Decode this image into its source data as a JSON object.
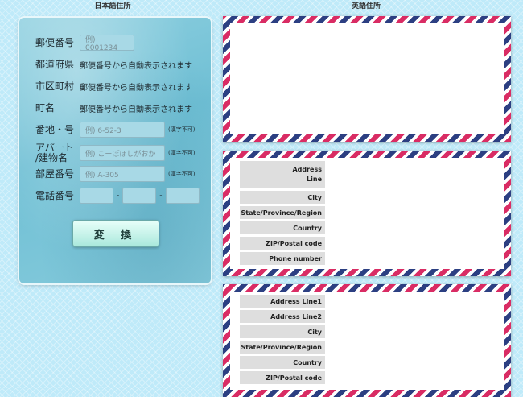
{
  "headings": {
    "japanese": "日本語住所",
    "english": "英語住所"
  },
  "form": {
    "postal": {
      "label": "郵便番号",
      "placeholder": "例) 0001234"
    },
    "prefecture": {
      "label": "都道府県",
      "auto": "郵便番号から自動表示されます"
    },
    "city": {
      "label": "市区町村",
      "auto": "郵便番号から自動表示されます"
    },
    "town": {
      "label": "町名",
      "auto": "郵便番号から自動表示されます"
    },
    "banchi": {
      "label": "番地・号",
      "placeholder": "例) 6-52-3",
      "note": "(漢字不可)"
    },
    "building": {
      "label_line1": "アパート",
      "label_line2": "/建物名",
      "placeholder": "例) こーぽほしがおか",
      "note": "(漢字不可)"
    },
    "room": {
      "label": "部屋番号",
      "placeholder": "例) A-305",
      "note": "(漢字不可)"
    },
    "phone": {
      "label": "電話番号",
      "sep": "-"
    },
    "convert_label": "変 換"
  },
  "envelope2": {
    "rows": [
      "Address Line",
      "City",
      "State/Province/Region",
      "Country",
      "ZIP/Postal code",
      "Phone number"
    ],
    "address_line1": "Address",
    "address_line2": "Line"
  },
  "envelope3": {
    "rows": [
      "Address Line1",
      "Address Line2",
      "City",
      "State/Province/Region",
      "Country",
      "ZIP/Postal code"
    ]
  },
  "colors": {
    "stripe_red": "#d92c64",
    "stripe_blue": "#2c3f82",
    "panel": "#7fc8db",
    "background": "#bfeaf9"
  }
}
